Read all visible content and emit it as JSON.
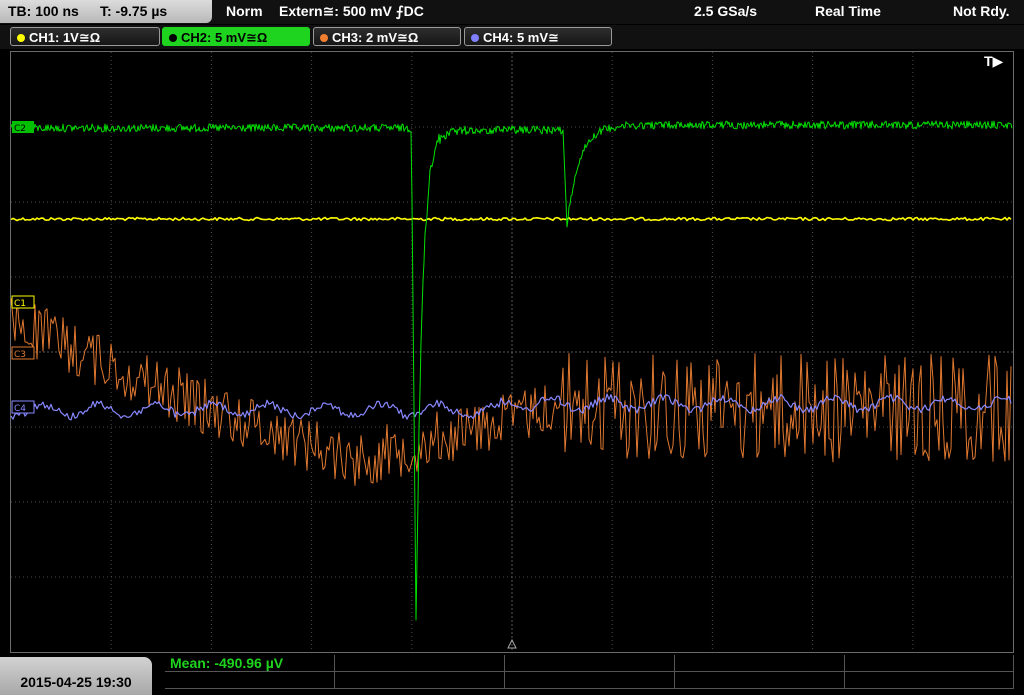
{
  "topbar": {
    "timebase": "TB: 100 ns",
    "trigger_time": "T: -9.75 µs",
    "mode": "Norm",
    "trigger_source": "Extern≅: 500 mV ⨍DC",
    "sample_rate": "2.5 GSa/s",
    "acq_mode": "Real Time",
    "status": "Not Rdy."
  },
  "channels": [
    {
      "label": "CH1: 1V≅Ω",
      "color": "#ffff00",
      "active": false
    },
    {
      "label": "CH2: 5 mV≅Ω",
      "color": "#00e000",
      "active": true
    },
    {
      "label": "CH3: 2 mV≅Ω",
      "color": "#f08030",
      "active": false
    },
    {
      "label": "CH4: 5 mV≅",
      "color": "#8080ff",
      "active": false
    }
  ],
  "trigger_marker": "T▶",
  "channel_markers": {
    "c1": "C1",
    "c2": "C2",
    "c3": "C3",
    "c4": "C4"
  },
  "bottom": {
    "datetime": "2015-04-25 19:30",
    "measurement": "Mean: -490.96 µV"
  },
  "colors": {
    "ch1": "#ffff00",
    "ch2": "#00e000",
    "ch3": "#e07830",
    "ch4": "#8888ff",
    "grid": "#4a4a4a"
  }
}
